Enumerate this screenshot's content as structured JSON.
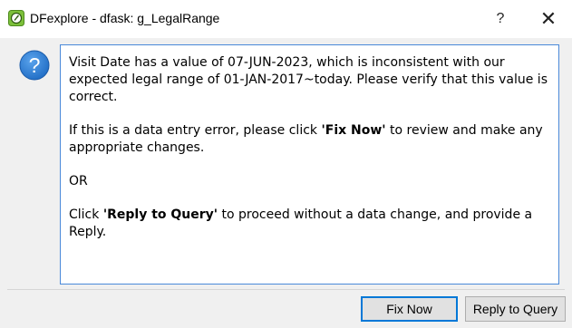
{
  "window": {
    "title": "DFexplore - dfask: g_LegalRange",
    "app_icon": "clock-badge-icon",
    "help_label": "?",
    "close_label": "✕"
  },
  "message": {
    "icon": "question-icon",
    "para1": "Visit Date has a value of 07-JUN-2023, which is inconsistent with our expected legal range of 01-JAN-2017~today. Please verify that this value is correct.",
    "para2_pre": "If this is a data entry error, please click ",
    "para2_bold": "'Fix Now'",
    "para2_post": " to review and make any appropriate changes.",
    "para3": "OR",
    "para4_pre": "Click ",
    "para4_bold": "'Reply to Query'",
    "para4_post": " to proceed without a data change, and provide a Reply."
  },
  "buttons": {
    "fix_now": "Fix Now",
    "reply_to_query": "Reply to Query"
  },
  "colors": {
    "accent": "#0078d7",
    "question_icon": "#2e7bd1",
    "app_icon": "#7cc03a"
  }
}
